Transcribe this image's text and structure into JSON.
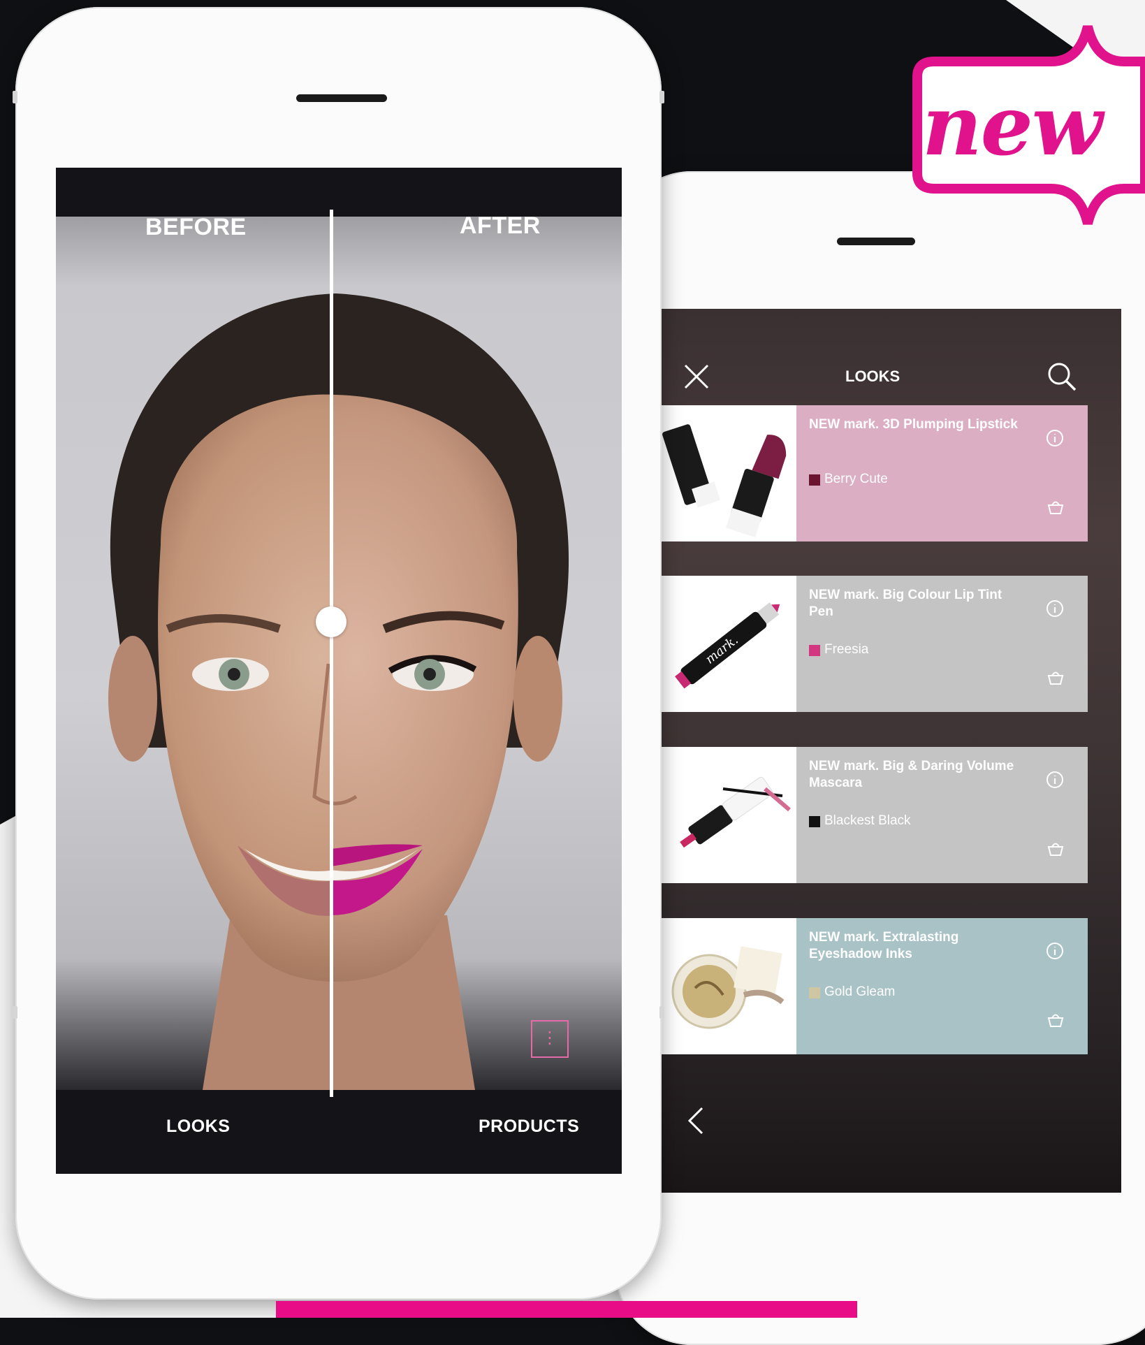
{
  "badge": {
    "text": "new"
  },
  "colors": {
    "brand_pink": "#e0138c",
    "bar_pink": "#e80d87"
  },
  "try_on": {
    "before_label": "BEFORE",
    "after_label": "AFTER",
    "tabs": [
      "LOOKS",
      "PRODUCTS"
    ],
    "more_icon": "more-vertical-icon"
  },
  "looks_panel": {
    "title": "LOOKS",
    "close_icon": "close-icon",
    "search_icon": "search-icon",
    "back_icon": "chevron-left-icon",
    "products": [
      {
        "name": "NEW mark. 3D Plumping Lipstick",
        "shade": "Berry Cute",
        "swatch": "#6b1530",
        "card_color": "#dcaec3",
        "image": "lipstick"
      },
      {
        "name": "NEW mark. Big Colour Lip Tint Pen",
        "shade": "Freesia",
        "swatch": "#d3377f",
        "card_color": "#c4c4c4",
        "image": "lip-tint-pen"
      },
      {
        "name": "NEW mark. Big & Daring Volume Mascara",
        "shade": "Blackest Black",
        "swatch": "#111111",
        "card_color": "#c4c4c4",
        "image": "mascara"
      },
      {
        "name": "NEW mark. Extralasting Eyeshadow Inks",
        "shade": "Gold Gleam",
        "swatch": "#cfc6a2",
        "card_color": "#a9c2c6",
        "image": "eyeshadow"
      }
    ]
  }
}
